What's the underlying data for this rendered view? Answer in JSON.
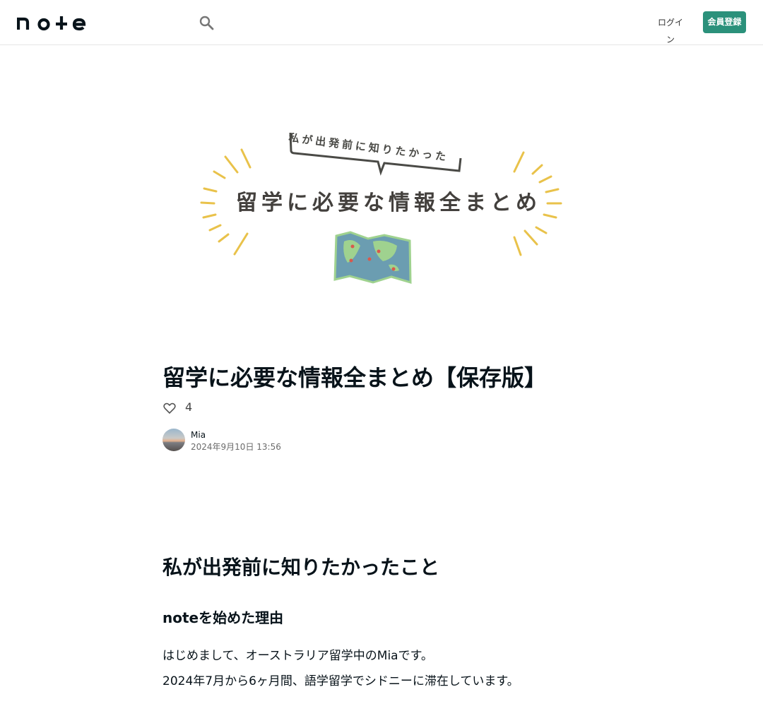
{
  "header": {
    "logo_text": "note",
    "search_icon": "search-icon",
    "login_label": "ログイン",
    "register_label": "会員登録"
  },
  "hero": {
    "bubble_text": "私が出発前に知りたかった",
    "main_text": "留学に必要な情報全まとめ",
    "illustration": "world-map-icon",
    "colors": {
      "rays": "#e9c24a",
      "map": "#6b9db1",
      "land": "#9fd28f",
      "text": "#43403d"
    }
  },
  "article": {
    "title": "留学に必要な情報全まとめ【保存版】",
    "likes": "4",
    "author_name": "Mia",
    "published": "2024年9月10日 13:56",
    "heading": "私が出発前に知りたかったこと",
    "subheading": "noteを始めた理由",
    "paragraph1": "はじめまして、オーストラリア留学中のMiaです。",
    "paragraph2": "2024年7月から6ヶ月間、語学留学でシドニーに滞在しています。"
  },
  "colors": {
    "accent": "#2b917b",
    "text": "#08131a"
  }
}
